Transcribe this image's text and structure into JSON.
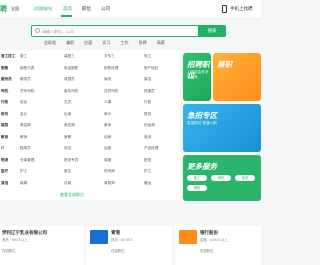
{
  "header": {
    "logo": "聘",
    "city": "全国",
    "switch_label": "[切换城市]",
    "nav": [
      "首页",
      "职位",
      "公司"
    ],
    "login": "手机上找聘"
  },
  "search": {
    "placeholder": "请输入职位、公司",
    "button": "搜索"
  },
  "categories": [
    "全职类",
    "兼职",
    "应届",
    "实习",
    "工作",
    "急聘",
    "高薪"
  ],
  "job_rows": [
    {
      "lead": "普工技工",
      "items": [
        "普工",
        "装配工",
        "叉车工",
        "电工",
        "焊工",
        "操作工"
      ]
    },
    {
      "lead": "销售",
      "items": [
        "销售代表",
        "电话销售",
        "销售经理",
        "房产经纪",
        "汽车销售",
        "渠道销售"
      ]
    },
    {
      "lead": "服务员",
      "items": [
        "服务员",
        "收银员",
        "保安",
        "保洁",
        "厨师",
        "配菜"
      ]
    },
    {
      "lead": "司机",
      "items": [
        "货车司机",
        "客车司机",
        "送货司机",
        "快递员",
        "骑手",
        "仓管"
      ]
    },
    {
      "lead": "行政",
      "items": [
        "前台",
        "文员",
        "人事",
        "行政",
        "助理",
        "客服"
      ]
    },
    {
      "lead": "财务",
      "items": [
        "会计",
        "出纳",
        "审计",
        "财务",
        "税务",
        "核算"
      ]
    },
    {
      "lead": "美容",
      "items": [
        "美容师",
        "美发师",
        "美甲",
        "化妆师",
        "按摩",
        "保健"
      ]
    },
    {
      "lead": "教育",
      "items": [
        "教师",
        "家教",
        "幼师",
        "培训",
        "课程顾问",
        "助教"
      ]
    },
    {
      "lead": "IT",
      "items": [
        "程序员",
        "测试",
        "运维",
        "产品经理",
        "设计师",
        "运营"
      ]
    },
    {
      "lead": "物流",
      "items": [
        "仓库管理",
        "物流专员",
        "调度",
        "配送",
        "理货",
        "分拣"
      ]
    },
    {
      "lead": "医疗",
      "items": [
        "护士",
        "医生",
        "药剂师",
        "护工",
        "导医",
        "检验"
      ]
    },
    {
      "lead": "其他",
      "items": [
        "保姆",
        "月嫂",
        "育婴师",
        "搬运",
        "装卸",
        "杂工"
      ]
    }
  ],
  "more_label": "查看全部职位",
  "side_cards": {
    "card1_title": "招聘职位",
    "card1_sub": "工作机会多多 等你来",
    "card1b_title": "兼职",
    "card2_title": "急招专区",
    "card2_sub": "急招职位 快速入职",
    "card3_title": "更多服务",
    "card3_pills": [
      "普工",
      "司机",
      "保安",
      "销售"
    ]
  },
  "companies": [
    {
      "name": "伊利辽宁乳业有限公司",
      "info": "食品 · 500人以上",
      "tag": "在招职位"
    },
    {
      "name": "青港",
      "info": "物流 · 50-99人",
      "tag": "在招职位"
    },
    {
      "name": "银行股份",
      "info": "金融 · 1000人以上",
      "tag": "在招职位"
    }
  ],
  "colors": {
    "brand": "#22b266",
    "accent_orange": "#ff8c1a",
    "accent_blue": "#1a8fd6"
  }
}
